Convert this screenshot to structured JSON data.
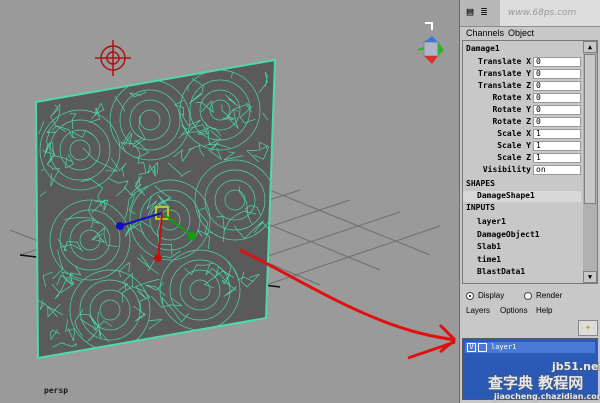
{
  "viewport": {
    "camera_label": "persp",
    "mesh_color": "#4dd9a8",
    "panel_color": "#5a5a5a",
    "annotation_color": "#e01010"
  },
  "channel_box": {
    "tabs": [
      "Channels",
      "Object"
    ],
    "node_name": "Damage1",
    "attributes": [
      {
        "label": "Translate X",
        "value": "0"
      },
      {
        "label": "Translate Y",
        "value": "0"
      },
      {
        "label": "Translate Z",
        "value": "0"
      },
      {
        "label": "Rotate X",
        "value": "0"
      },
      {
        "label": "Rotate Y",
        "value": "0"
      },
      {
        "label": "Rotate Z",
        "value": "0"
      },
      {
        "label": "Scale X",
        "value": "1"
      },
      {
        "label": "Scale Y",
        "value": "1"
      },
      {
        "label": "Scale Z",
        "value": "1"
      },
      {
        "label": "Visibility",
        "value": "on"
      }
    ],
    "shapes_header": "SHAPES",
    "shape_item": "DamageShape1",
    "inputs_header": "INPUTS",
    "inputs": [
      "layer1",
      "DamageObject1",
      "Slab1",
      "time1",
      "BlastData1"
    ]
  },
  "layer_editor": {
    "radio_display": "Display",
    "radio_render": "Render",
    "menu": [
      "Layers",
      "Options",
      "Help"
    ],
    "layer_visible_mark": "V",
    "layer_name": "layer1"
  },
  "watermark": {
    "top_text": "www.68ps.com",
    "site": "jb51.net",
    "brand": "查字典 教程网",
    "url": "jiaocheng.chazidian.com"
  }
}
